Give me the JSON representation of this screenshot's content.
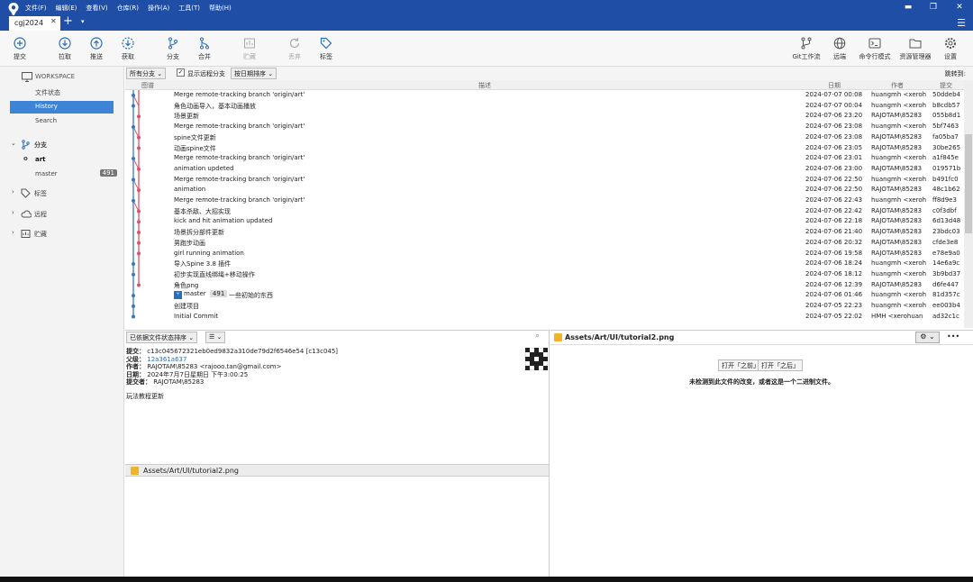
{
  "menu": [
    "文件(F)",
    "编辑(E)",
    "查看(V)",
    "仓库(R)",
    "操作(A)",
    "工具(T)",
    "帮助(H)"
  ],
  "tab": {
    "label": "cgj2024",
    "close": "✕",
    "add": "+",
    "dropdown": "▾"
  },
  "window": {
    "minimize": "▬",
    "maximize": "❐",
    "close": "✕",
    "hamburger": "☰"
  },
  "toolbar": {
    "commit": "提交",
    "pull": "拉取",
    "push": "推送",
    "fetch": "获取",
    "branch": "分支",
    "merge": "合并",
    "stash": "贮藏",
    "discard": "丢弃",
    "tag": "标签",
    "git_flow": "Git工作流",
    "remote": "远端",
    "terminal": "命令行模式",
    "explorer": "资源管理器",
    "settings": "设置"
  },
  "sidebar": {
    "workspace": "WORKSPACE",
    "file_status": "文件状态",
    "history": "History",
    "search": "Search",
    "branches": "分支",
    "branch_items": [
      {
        "name": "art"
      },
      {
        "name": "master",
        "badge": "491"
      }
    ],
    "tags": "标签",
    "remotes": "远程",
    "stashes": "贮藏"
  },
  "filters": {
    "branches": "所有分支 ⌄",
    "show_remote": "显示远程分支",
    "sort": "按日期排序 ⌄",
    "jump": "跳转到:"
  },
  "columns": {
    "graph": "图谱",
    "description": "描述",
    "date": "日期",
    "author": "作者",
    "commit": "提交"
  },
  "commits": [
    {
      "desc": "Merge remote-tracking branch 'origin/art'",
      "date": "2024-07-07 00:08",
      "author": "huangmh <xeroh",
      "hash": "50ddeb4"
    },
    {
      "desc": "角色动画导入，基本动画播放",
      "date": "2024-07-07 00:04",
      "author": "huangmh <xeroh",
      "hash": "b8cdb57"
    },
    {
      "desc": "场景更新",
      "date": "2024-07-06 23:20",
      "author": "RAJOTAM\\85283",
      "hash": "055b8d1"
    },
    {
      "desc": "Merge remote-tracking branch 'origin/art'",
      "date": "2024-07-06 23:08",
      "author": "huangmh <xeroh",
      "hash": "5bf7463"
    },
    {
      "desc": "spine文件更新",
      "date": "2024-07-06 23:08",
      "author": "RAJOTAM\\85283",
      "hash": "fa05ba7"
    },
    {
      "desc": "动画spine文件",
      "date": "2024-07-06 23:05",
      "author": "RAJOTAM\\85283",
      "hash": "30be265"
    },
    {
      "desc": "Merge remote-tracking branch 'origin/art'",
      "date": "2024-07-06 23:01",
      "author": "huangmh <xeroh",
      "hash": "a1f845e"
    },
    {
      "desc": "animation updeted",
      "date": "2024-07-06 23:00",
      "author": "RAJOTAM\\85283",
      "hash": "019571b"
    },
    {
      "desc": "Merge remote-tracking branch 'origin/art'",
      "date": "2024-07-06 22:50",
      "author": "huangmh <xeroh",
      "hash": "b491fc0"
    },
    {
      "desc": "animation",
      "date": "2024-07-06 22:50",
      "author": "RAJOTAM\\85283",
      "hash": "48c1b62"
    },
    {
      "desc": "Merge remote-tracking branch 'origin/art'",
      "date": "2024-07-06 22:43",
      "author": "huangmh <xeroh",
      "hash": "ff8d9e3"
    },
    {
      "desc": "基本杀敌、大招实现",
      "date": "2024-07-06 22:42",
      "author": "RAJOTAM\\85283",
      "hash": "c0f3dbf"
    },
    {
      "desc": "kick and hit animation updated",
      "date": "2024-07-06 22:18",
      "author": "RAJOTAM\\85283",
      "hash": "6d13d48"
    },
    {
      "desc": "场景拆分部件更新",
      "date": "2024-07-06 21:40",
      "author": "RAJOTAM\\85283",
      "hash": "23bdc03"
    },
    {
      "desc": "男跑步动画",
      "date": "2024-07-06 20:32",
      "author": "RAJOTAM\\85283",
      "hash": "cfde3e8"
    },
    {
      "desc": "girl running animation",
      "date": "2024-07-06 19:58",
      "author": "RAJOTAM\\85283",
      "hash": "e78e9a0"
    },
    {
      "desc": "导入Spine 3.8 插件",
      "date": "2024-07-06 18:24",
      "author": "huangmh <xeroh",
      "hash": "14e6a9c"
    },
    {
      "desc": "初步实现直线绑绳+移动操作",
      "date": "2024-07-06 18:12",
      "author": "huangmh <xeroh",
      "hash": "3b9bd37"
    },
    {
      "desc": "角色png",
      "date": "2024-07-06 12:39",
      "author": "RAJOTAM\\85283",
      "hash": "d6fe447"
    },
    {
      "desc": "一些初始的东西",
      "date": "2024-07-06 01:46",
      "author": "huangmh <xeroh",
      "hash": "81d357c",
      "branch": "master",
      "badge": "491"
    },
    {
      "desc": "创建项目",
      "date": "2024-07-05 22:23",
      "author": "huangmh <xeroh",
      "hash": "ee003b4"
    },
    {
      "desc": "Initial Commit",
      "date": "2024-07-05 22:02",
      "author": "HMH <xerohuan",
      "hash": "ad32c1c"
    }
  ],
  "graph_colors": {
    "main": "#3b78b8",
    "branch": "#e0506a"
  },
  "details": {
    "sort": "已依据文件状态排序 ⌄",
    "view": "☰ ⌄",
    "commit_label": "提交：",
    "commit_value": "c13c045672321eb0ed9832a310de79d2f6546e54 [c13c045]",
    "parent_label": "父级：",
    "parent_value": "12a361a637",
    "author_label": "作者：",
    "author_value": "RAJOTAM\\85283 <rajooo.tan@gmail.com>",
    "date_label": "日期：",
    "date_value": "2024年7月7日星期日 下午3:00:25",
    "committer_label": "提交者：",
    "committer_value": "RAJOTAM\\85283",
    "message": "玩法教程更新",
    "file": "Assets/Art/UI/tutorial2.png"
  },
  "diff": {
    "file": "Assets/Art/UI/tutorial2.png",
    "open_before": "打开「之前」",
    "open_after": "打开「之后」",
    "message": "未检测到此文件的改变，或者这是一个二进制文件。",
    "more": "•••"
  }
}
